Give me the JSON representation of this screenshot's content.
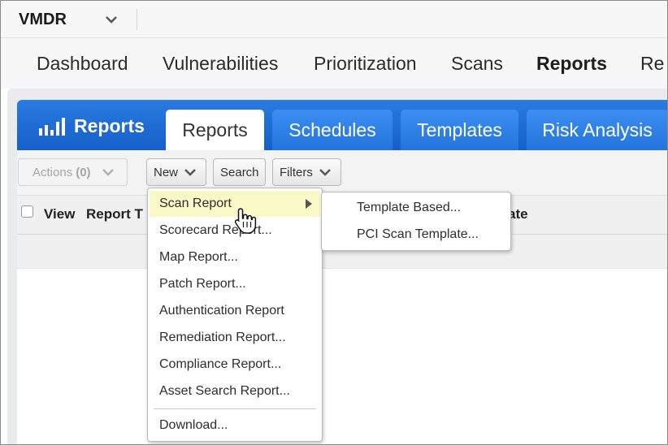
{
  "app": {
    "name": "VMDR"
  },
  "nav": {
    "items": [
      {
        "label": "Dashboard"
      },
      {
        "label": "Vulnerabilities"
      },
      {
        "label": "Prioritization"
      },
      {
        "label": "Scans"
      },
      {
        "label": "Reports",
        "active": true
      },
      {
        "label": "Re"
      }
    ]
  },
  "module": {
    "title": "Reports",
    "icon": "bar-chart-icon"
  },
  "tabs": [
    {
      "label": "Reports",
      "active": true
    },
    {
      "label": "Schedules"
    },
    {
      "label": "Templates"
    },
    {
      "label": "Risk Analysis"
    }
  ],
  "toolbar": {
    "actions_label": "Actions",
    "actions_count": "(0)",
    "new_label": "New",
    "search_label": "Search",
    "filters_label": "Filters"
  },
  "table": {
    "columns": [
      {
        "label": "View"
      },
      {
        "label": "Report T"
      },
      {
        "label": "ate"
      }
    ]
  },
  "new_menu": {
    "items": [
      {
        "label": "Scan Report",
        "highlighted": true,
        "has_submenu": true
      },
      {
        "label": "Scorecard Report..."
      },
      {
        "label": "Map Report..."
      },
      {
        "label": "Patch Report..."
      },
      {
        "label": "Authentication Report"
      },
      {
        "label": "Remediation Report..."
      },
      {
        "label": "Compliance Report..."
      },
      {
        "label": "Asset Search Report..."
      },
      {
        "label": "Download..."
      }
    ]
  },
  "scan_report_submenu": {
    "items": [
      {
        "label": "Template Based..."
      },
      {
        "label": "PCI Scan Template..."
      }
    ]
  },
  "colors": {
    "accent_blue": "#1c6ad6",
    "highlight_yellow": "#fbf8c8"
  }
}
